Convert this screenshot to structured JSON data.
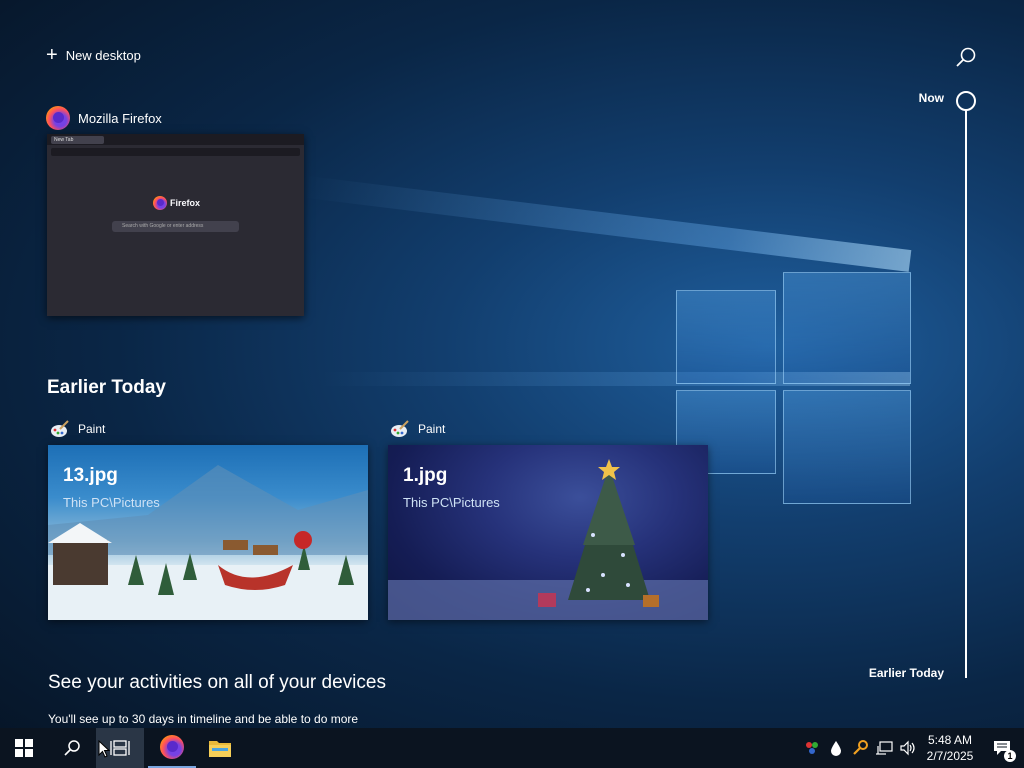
{
  "header": {
    "new_desktop_label": "New desktop"
  },
  "timeline": {
    "now_label": "Now",
    "earlier_label": "Earlier Today"
  },
  "firefox_card": {
    "app_name": "Mozilla Firefox",
    "thumb_tab": "New Tab",
    "thumb_brand": "Firefox",
    "thumb_search": "Search with Google or enter address"
  },
  "earlier_today": {
    "heading": "Earlier Today",
    "cards": [
      {
        "app": "Paint",
        "title": "13.jpg",
        "path": "This PC\\Pictures"
      },
      {
        "app": "Paint",
        "title": "1.jpg",
        "path": "This PC\\Pictures"
      }
    ]
  },
  "bottom": {
    "heading": "See your activities on all of your devices",
    "subtext": "You'll see up to 30 days in timeline and be able to do more"
  },
  "taskbar": {
    "clock_time": "5:48 AM",
    "clock_date": "2/7/2025",
    "notification_count": "1"
  },
  "colors": {
    "taskbar_bg": "#0b1420",
    "accent": "#7aa6e0"
  }
}
